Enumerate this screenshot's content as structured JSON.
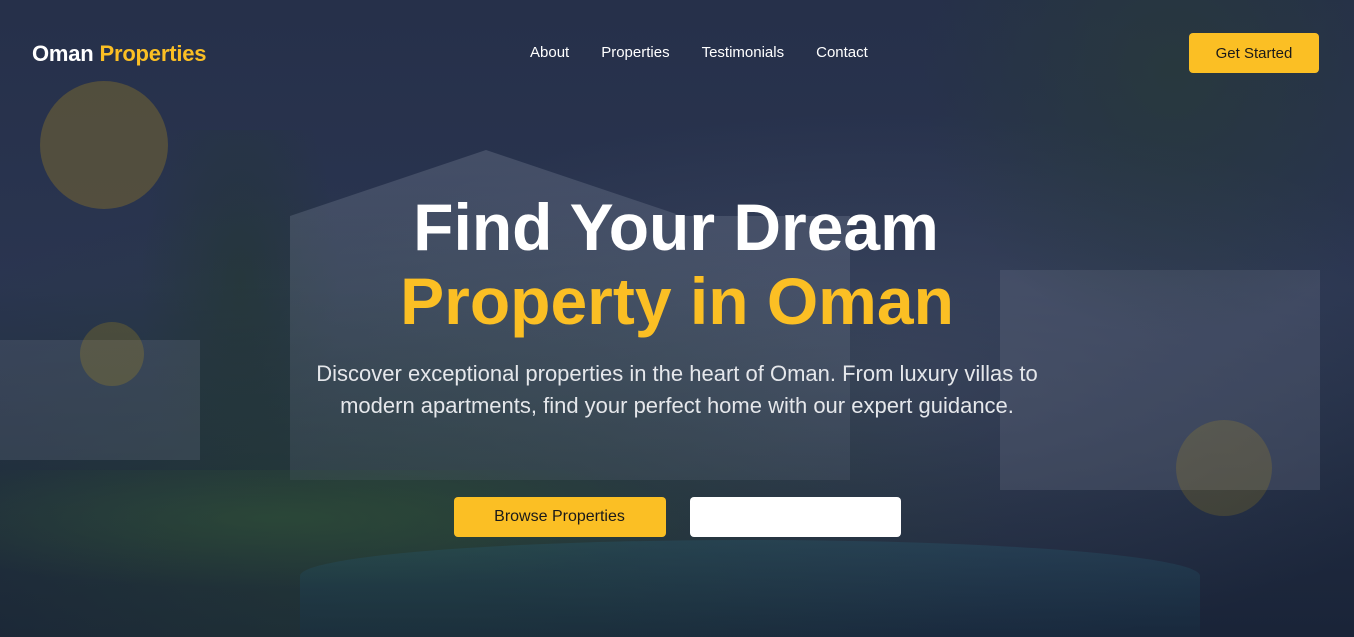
{
  "brand": {
    "name_part1": "Oman",
    "name_part2": "Properties",
    "accent_color": "#fbbf24"
  },
  "nav": {
    "links": [
      "About",
      "Properties",
      "Testimonials",
      "Contact"
    ],
    "cta_label": "Get Started"
  },
  "hero": {
    "title_line1": "Find Your Dream",
    "title_line2": "Property in Oman",
    "description": "Discover exceptional properties in the heart of Oman. From luxury villas to modern apartments, find your perfect home with our expert guidance.",
    "primary_button": "Browse Properties",
    "secondary_button": ""
  },
  "colors": {
    "background": "#1e2a45",
    "accent": "#fbbf24",
    "text": "#ffffff"
  }
}
